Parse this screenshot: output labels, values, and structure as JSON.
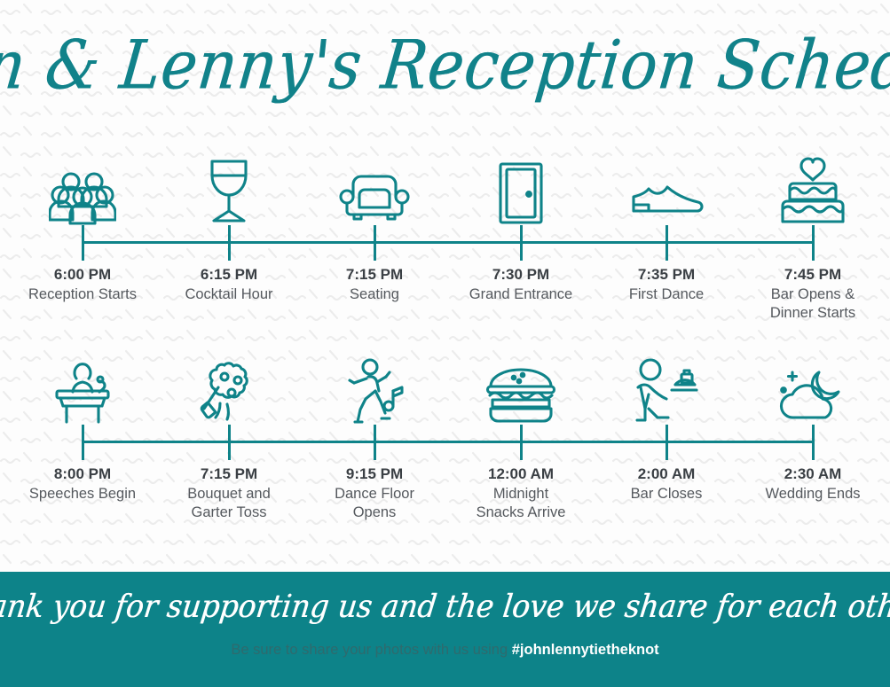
{
  "theme": {
    "teal": "#0f8389",
    "teal_dark": "#117d85",
    "title_color": "#11828a",
    "page_bg": "#fdfdfd",
    "pattern_color": "#ececec",
    "time_color": "#3a3f44",
    "desc_color": "#55595e",
    "footer_bg": "#0d8389",
    "footer_text": "#2f6a6d",
    "footer_hashtag_color": "#ffffff"
  },
  "header": {
    "title": "John & Lenny's Reception Schedule"
  },
  "timeline": {
    "rows": [
      {
        "row_name": "evening-schedule-row",
        "events": [
          {
            "icon": "group-of-people-icon",
            "time": "6:00 PM",
            "desc_lines": [
              "Reception Starts"
            ]
          },
          {
            "icon": "wine-glass-icon",
            "time": "6:15 PM",
            "desc_lines": [
              "Cocktail Hour"
            ]
          },
          {
            "icon": "armchair-icon",
            "time": "7:15 PM",
            "desc_lines": [
              "Seating"
            ]
          },
          {
            "icon": "door-icon",
            "time": "7:30 PM",
            "desc_lines": [
              "Grand Entrance"
            ]
          },
          {
            "icon": "dress-shoe-icon",
            "time": "7:35 PM",
            "desc_lines": [
              "First Dance"
            ]
          },
          {
            "icon": "wedding-cake-icon",
            "time": "7:45 PM",
            "desc_lines": [
              "Bar Opens &",
              "Dinner Starts"
            ]
          }
        ]
      },
      {
        "row_name": "late-night-schedule-row",
        "events": [
          {
            "icon": "podium-speaker-icon",
            "time": "8:00 PM",
            "desc_lines": [
              "Speeches Begin"
            ]
          },
          {
            "icon": "bouquet-icon",
            "time": "7:15 PM",
            "desc_lines": [
              "Bouquet and",
              "Garter Toss"
            ]
          },
          {
            "icon": "dancing-person-icon",
            "time": "9:15 PM",
            "desc_lines": [
              "Dance Floor",
              "Opens"
            ]
          },
          {
            "icon": "burger-icon",
            "time": "12:00 AM",
            "desc_lines": [
              "Midnight",
              "Snacks Arrive"
            ]
          },
          {
            "icon": "waiter-tray-icon",
            "time": "2:00 AM",
            "desc_lines": [
              "Bar Closes"
            ]
          },
          {
            "icon": "moon-cloud-icon",
            "time": "2:30 AM",
            "desc_lines": [
              "Wedding Ends"
            ]
          }
        ]
      }
    ],
    "tick_positions": [
      93,
      258,
      422,
      587,
      751,
      916
    ]
  },
  "footer": {
    "thanks": "Thank you for supporting us and the love we share for each other!",
    "share_text": "Be sure to share your photos with us using ",
    "hashtag": "#johnlennytietheknot"
  }
}
